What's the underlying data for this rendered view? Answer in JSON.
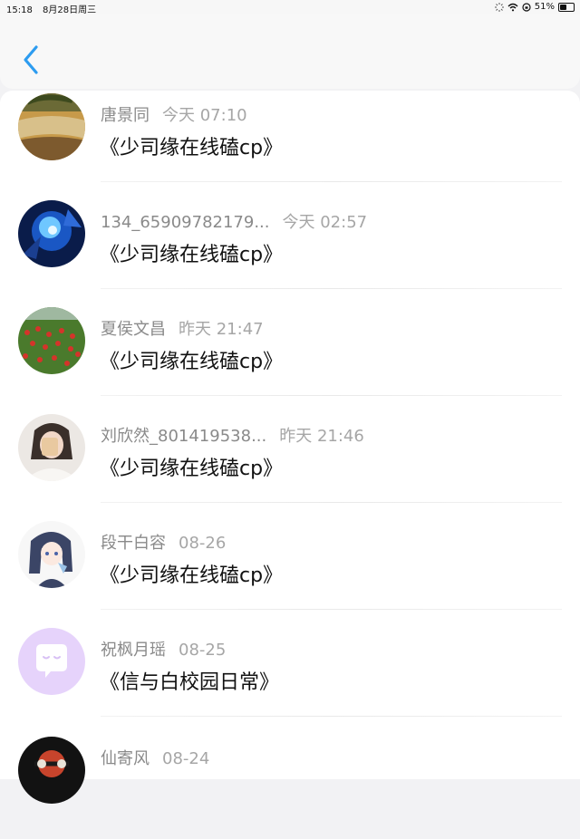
{
  "status": {
    "time": "15:18",
    "date": "8月28日周三",
    "battery_text": "51%",
    "battery_level": 0.51
  },
  "nav": {
    "back_icon": "chevron-left-icon",
    "accent": "#2d9cf0"
  },
  "items": [
    {
      "name": "唐景同",
      "time": "今天 07:10",
      "title": "《少司缘在线磕cp》"
    },
    {
      "name": "134_65909782179...",
      "time": "今天 02:57",
      "title": "《少司缘在线磕cp》"
    },
    {
      "name": "夏侯文昌",
      "time": "昨天 21:47",
      "title": "《少司缘在线磕cp》"
    },
    {
      "name": "刘欣然_801419538...",
      "time": "昨天 21:46",
      "title": "《少司缘在线磕cp》"
    },
    {
      "name": "段干白容",
      "time": "08-26",
      "title": "《少司缘在线磕cp》"
    },
    {
      "name": "祝枫月瑶",
      "time": "08-25",
      "title": "《信与白校园日常》"
    },
    {
      "name": "仙寄风",
      "time": "08-24",
      "title": ""
    }
  ]
}
